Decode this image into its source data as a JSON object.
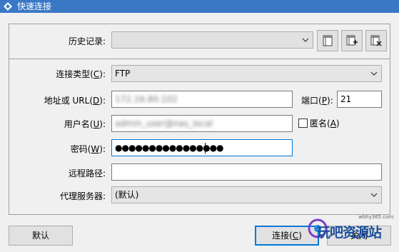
{
  "window": {
    "title": "快速连接"
  },
  "history": {
    "label": "历史记录:",
    "value": "",
    "buttons": [
      "open-history",
      "add-history",
      "delete-history"
    ]
  },
  "connection_type": {
    "label": "连接类型(",
    "hotkey": "C",
    "label_end": "):",
    "value": "FTP"
  },
  "address": {
    "label": "地址或 URL(",
    "hotkey": "D",
    "label_end": "):",
    "value": "172.16.80.102"
  },
  "port": {
    "label": "端口(",
    "hotkey": "P",
    "label_end": "):",
    "value": "21"
  },
  "username": {
    "label": "用户名(",
    "hotkey": "U",
    "label_end": "):",
    "value": "admin_user@nas_local"
  },
  "anonymous": {
    "label": "匿名(",
    "hotkey": "A",
    "label_end": ")",
    "checked": false
  },
  "password": {
    "label": "密码(",
    "hotkey": "W",
    "label_end": "):",
    "value": "●●●●●●●●●●●●●●●●"
  },
  "remote_path": {
    "label": "远程路径:",
    "value": ""
  },
  "proxy": {
    "label": "代理服务器:",
    "value": "(默认)"
  },
  "buttons": {
    "default": "默认",
    "connect": "连接(",
    "connect_hotkey": "C",
    "connect_end": ")",
    "close": "关闭"
  },
  "watermark": {
    "site": "wbhy365.com",
    "brand": "玩吧资源站"
  }
}
